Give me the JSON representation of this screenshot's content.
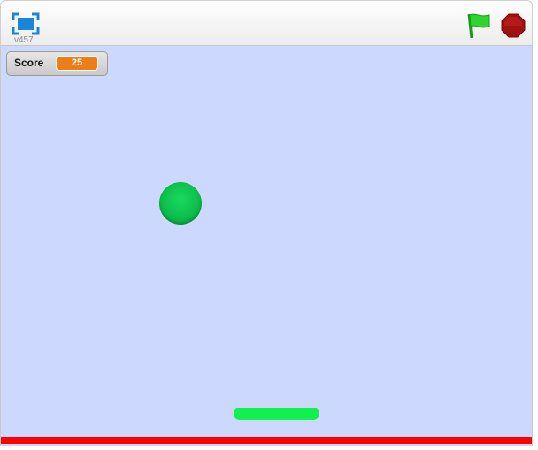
{
  "toolbar": {
    "version_label": "v457",
    "flag_color": "#2fd52f",
    "stop_color": "#a01010",
    "icons": [
      "fullscreen-icon",
      "green-flag-icon",
      "stop-icon"
    ]
  },
  "stage": {
    "background_color": "#cdd8ff",
    "monitor": {
      "label": "Score",
      "value": "25",
      "value_color": "#ee7d16"
    },
    "ball_color": "#0bbf4a",
    "paddle_color": "#10f04f",
    "floor_color": "#ff0000"
  }
}
